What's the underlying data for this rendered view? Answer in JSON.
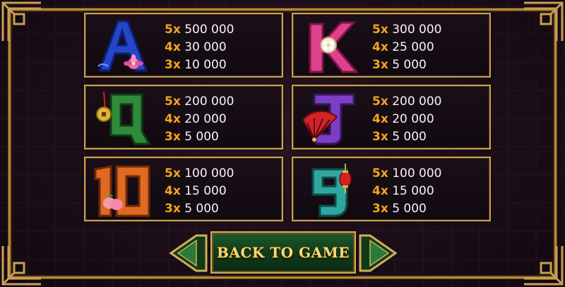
{
  "paytable": [
    {
      "symbol": "A",
      "symbol_icon": "letter-a-lotus-icon",
      "color": "#2546c8",
      "pays": [
        {
          "mult": "5x",
          "amount": "500 000"
        },
        {
          "mult": "4x",
          "amount": "30 000"
        },
        {
          "mult": "3x",
          "amount": "10 000"
        }
      ]
    },
    {
      "symbol": "K",
      "symbol_icon": "letter-k-flower-icon",
      "color": "#e0418f",
      "pays": [
        {
          "mult": "5x",
          "amount": "300 000"
        },
        {
          "mult": "4x",
          "amount": "25 000"
        },
        {
          "mult": "3x",
          "amount": "5 000"
        }
      ]
    },
    {
      "symbol": "Q",
      "symbol_icon": "letter-q-coin-icon",
      "color": "#2f8a3a",
      "pays": [
        {
          "mult": "5x",
          "amount": "200 000"
        },
        {
          "mult": "4x",
          "amount": "20 000"
        },
        {
          "mult": "3x",
          "amount": "5 000"
        }
      ]
    },
    {
      "symbol": "J",
      "symbol_icon": "letter-j-fan-icon",
      "color": "#7a3fc4",
      "pays": [
        {
          "mult": "5x",
          "amount": "200 000"
        },
        {
          "mult": "4x",
          "amount": "20 000"
        },
        {
          "mult": "3x",
          "amount": "5 000"
        }
      ]
    },
    {
      "symbol": "10",
      "symbol_icon": "number-10-peach-icon",
      "color": "#e06a24",
      "pays": [
        {
          "mult": "5x",
          "amount": "100 000"
        },
        {
          "mult": "4x",
          "amount": "15 000"
        },
        {
          "mult": "3x",
          "amount": "5 000"
        }
      ]
    },
    {
      "symbol": "9",
      "symbol_icon": "number-9-lantern-icon",
      "color": "#2fa7a0",
      "pays": [
        {
          "mult": "5x",
          "amount": "100 000"
        },
        {
          "mult": "4x",
          "amount": "15 000"
        },
        {
          "mult": "3x",
          "amount": "5 000"
        }
      ]
    }
  ],
  "back_button": {
    "label": "BACK TO GAME"
  },
  "theme": {
    "gold": "#c9a052",
    "multiplier": "#f3a51b",
    "button_green": "#1f5a2c"
  }
}
